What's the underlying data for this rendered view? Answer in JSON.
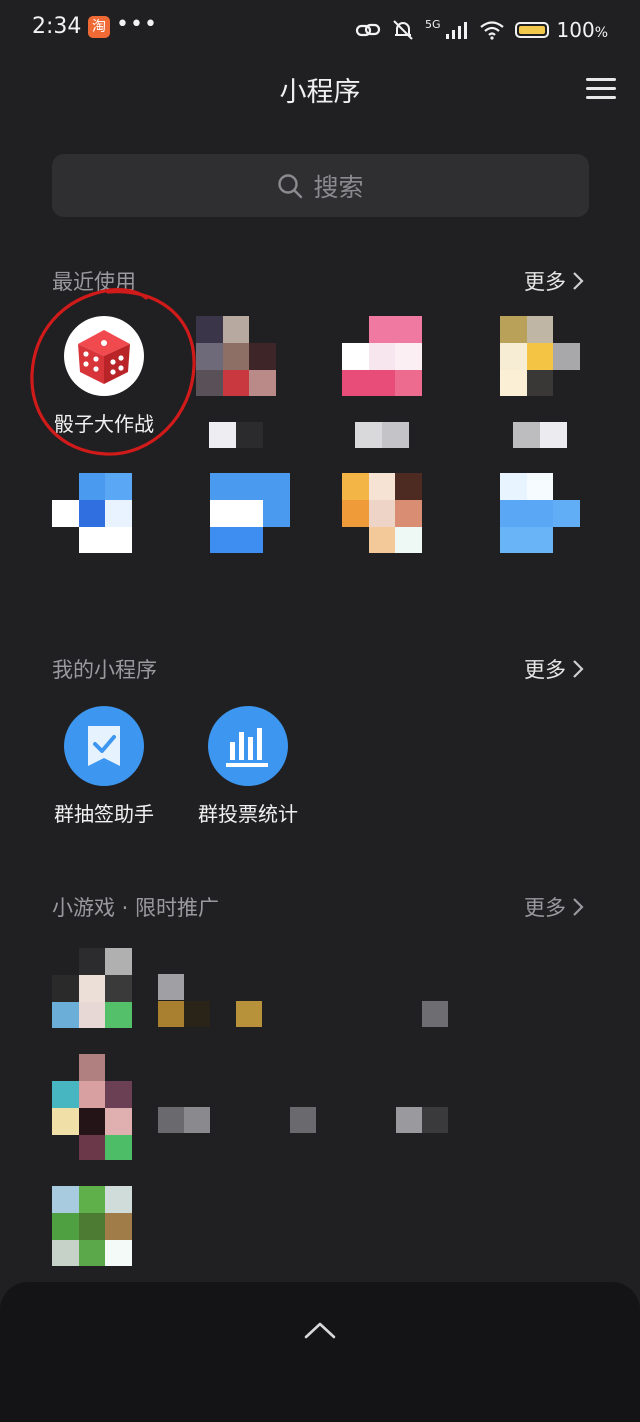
{
  "status": {
    "time": "2:34",
    "taobao_label": "淘",
    "dots": "•••",
    "network": "5G",
    "battery": "100",
    "battery_unit": "%"
  },
  "header": {
    "title": "小程序"
  },
  "search": {
    "placeholder": "搜索"
  },
  "recent": {
    "title": "最近使用",
    "more": "更多",
    "featured_label": "骰子大作战"
  },
  "mine": {
    "title": "我的小程序",
    "more": "更多",
    "items": [
      {
        "label": "群抽签助手"
      },
      {
        "label": "群投票统计"
      }
    ]
  },
  "games": {
    "title": "小游戏 · 限时推广",
    "more": "更多"
  },
  "colors": {
    "background": "#202022",
    "search_bg": "#2f2f31",
    "accent_blue": "#3d96f0",
    "dice_red": "#d8353a",
    "annotation_red": "#d11a1a"
  }
}
